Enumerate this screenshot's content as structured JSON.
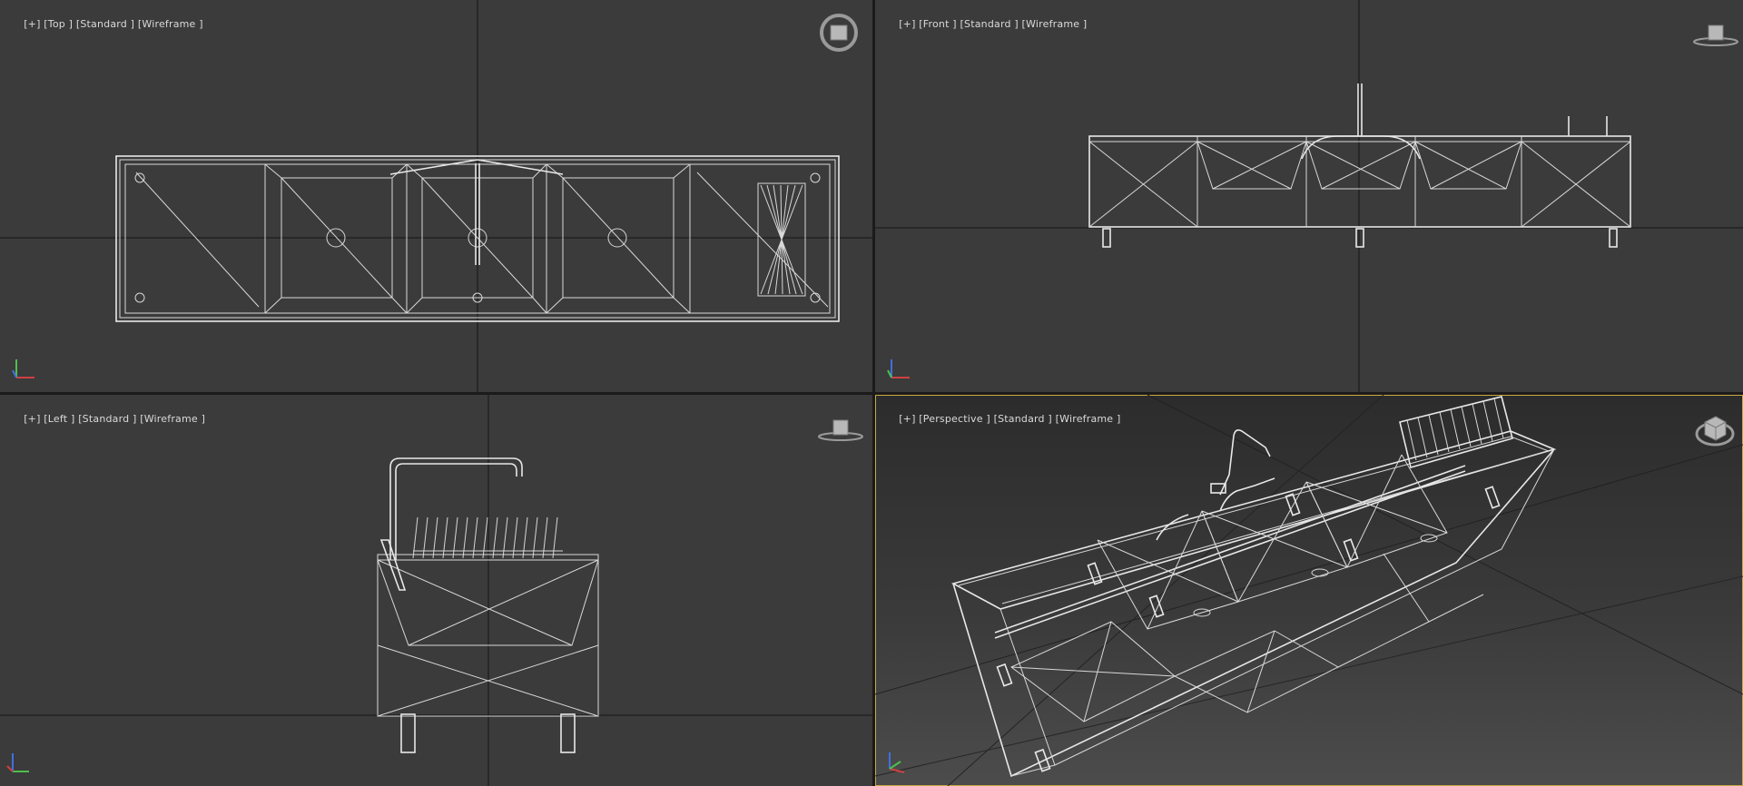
{
  "viewports": {
    "top": {
      "plus": "[+]",
      "view": "[Top ]",
      "shading": "[Standard ]",
      "mode": "[Wireframe ]"
    },
    "front": {
      "plus": "[+]",
      "view": "[Front ]",
      "shading": "[Standard ]",
      "mode": "[Wireframe ]"
    },
    "left": {
      "plus": "[+]",
      "view": "[Left ]",
      "shading": "[Standard ]",
      "mode": "[Wireframe ]"
    },
    "persp": {
      "plus": "[+]",
      "view": "[Perspective ]",
      "shading": "[Standard ]",
      "mode": "[Wireframe ]"
    }
  },
  "active_viewport": "persp",
  "colors": {
    "viewport_bg": "#3b3b3b",
    "wire": "#d8d8d8",
    "active_border": "#c9a944",
    "axis_x": "#d04040",
    "axis_y": "#4cc04c",
    "axis_z": "#4070e0"
  },
  "icons": {
    "viewcube": "viewcube-icon",
    "axis_tripod": "axis-tripod-icon"
  }
}
